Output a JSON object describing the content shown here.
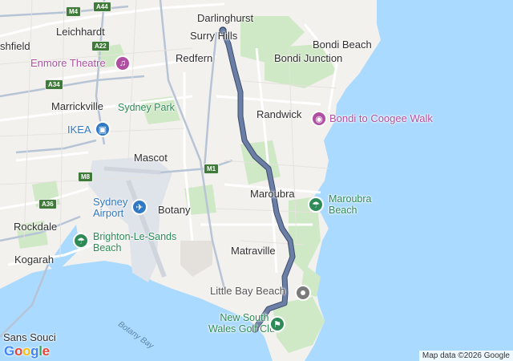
{
  "map": {
    "places": {
      "darlinghurst": "Darlinghurst",
      "surry_hills": "Surry Hills",
      "leichhardt": "Leichhardt",
      "ashfield": "shfield",
      "redfern": "Redfern",
      "bondi_beach": "Bondi Beach",
      "bondi_junction": "Bondi Junction",
      "marrickville": "Marrickville",
      "randwick": "Randwick",
      "mascot": "Mascot",
      "maroubra": "Maroubra",
      "rockdale": "Rockdale",
      "botany": "Botany",
      "kogarah": "Kogarah",
      "matraville": "Matraville",
      "sans_souci": "Sans Souci"
    },
    "pois": {
      "enmore": "Enmore Theatre",
      "sydney_park": "Sydney Park",
      "ikea": "IKEA",
      "airport": "Sydney\nAirport",
      "bondi_coogee": "Bondi to Coogee Walk",
      "maroubra_beach": "Maroubra\nBeach",
      "brighton": "Brighton-Le-Sands\nBeach",
      "little_bay": "Little Bay Beach",
      "golf": "New South\nWales Golf Club"
    },
    "water": {
      "botany_bay": "Botany Bay"
    },
    "roads": {
      "m4": "M4",
      "a44": "A44",
      "a22": "A22",
      "a34": "A34",
      "m1": "M1",
      "m8": "M8",
      "a36": "A36"
    },
    "icons": {
      "theatre": "theatre-icon",
      "park": "park-icon",
      "shopping": "shopping-bag-icon",
      "airport": "airplane-icon",
      "beach": "beach-icon",
      "golf": "golf-icon",
      "place": "place-dot-icon",
      "camera": "camera-icon"
    },
    "colors": {
      "sea": "#aadaff",
      "land": "#f3f1ee",
      "green": "#cfe8c5",
      "route": "#6b7fa6",
      "route_edge": "#3b4a6b"
    },
    "logo": "Google",
    "attribution": "Map data ©2026 Google"
  }
}
